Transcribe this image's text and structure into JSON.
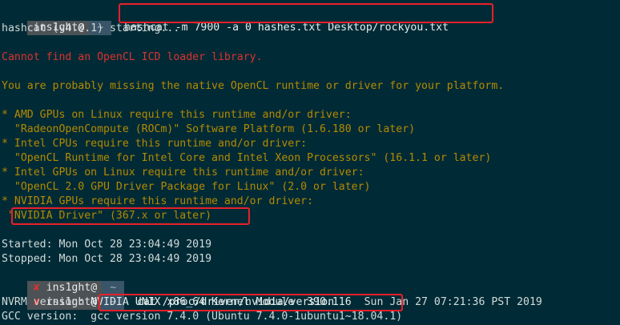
{
  "colors": {
    "background": "#002b36",
    "text": "#d3dbdb",
    "warning_yellow": "#b58900",
    "error_red": "#dc322f",
    "highlight_border": "#e8202a"
  },
  "prompt1": {
    "user": "ins1ght@",
    "dir": "~",
    "command": "hashcat -m 7900 -a 0 hashes.txt Desktop/rockyou.txt"
  },
  "output": {
    "starting": "hashcat (v4.0.1) starting...",
    "error": "Cannot find an OpenCL ICD loader library.",
    "missing": "You are probably missing the native OpenCL runtime or driver for your platform.",
    "amd_req": "* AMD GPUs on Linux require this runtime and/or driver:",
    "amd_drv": "  \"RadeonOpenCompute (ROCm)\" Software Platform (1.6.180 or later)",
    "intel_cpu_req": "* Intel CPUs require this runtime and/or driver:",
    "intel_cpu_drv": "  \"OpenCL Runtime for Intel Core and Intel Xeon Processors\" (16.1.1 or later)",
    "intel_gpu_req": "* Intel GPUs on Linux require this runtime and/or driver:",
    "intel_gpu_drv": "  \"OpenCL 2.0 GPU Driver Package for Linux\" (2.0 or later)",
    "nvidia_req": "* NVIDIA GPUs require this runtime and/or driver:",
    "nvidia_drv": " \"NVIDIA Driver\" (367.x or later)",
    "started": "Started: Mon Oct 28 23:04:49 2019",
    "stopped": "Stopped: Mon Oct 28 23:04:49 2019"
  },
  "prompt2": {
    "x": "✘",
    "user": "ins1ght@",
    "dir": "~"
  },
  "prompt3": {
    "x": "✘",
    "user": "ins1ght@",
    "dir": "~",
    "command": "cat /proc/driver/nvidia/version"
  },
  "version": {
    "nvrm_label": "NVRM version: ",
    "nvrm_value": "NVIDIA UNIX x86_64 Kernel Module  390.116",
    "nvrm_date": "  Sun Jan 27 07:21:36 PST 2019",
    "gcc_label": "GCC version:  ",
    "gcc_value": "gcc version 7.4.0 (Ubuntu 7.4.0-1ubuntu1~18.04.1)"
  }
}
